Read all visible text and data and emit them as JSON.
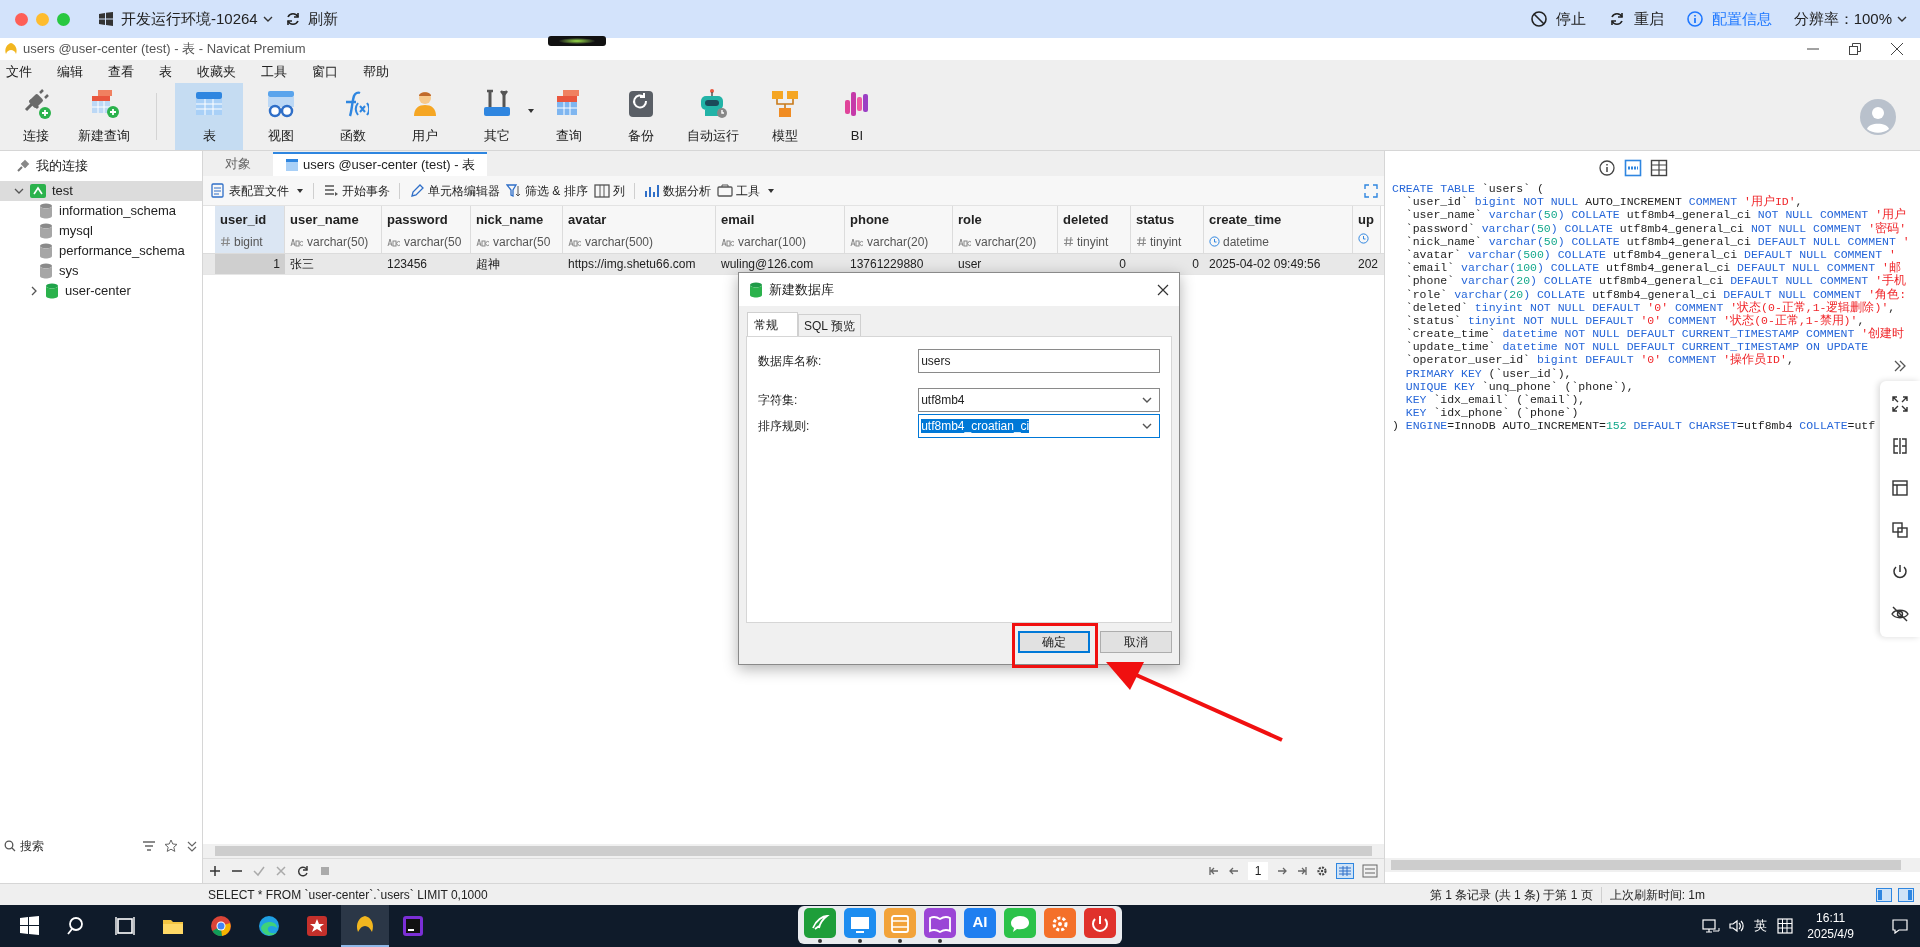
{
  "top_bar": {
    "environment": "开发运行环境-10264",
    "refresh": "刷新",
    "actions": [
      {
        "label": "停止",
        "kind": "stop"
      },
      {
        "label": "重启",
        "kind": "restart"
      },
      {
        "label": "配置信息",
        "kind": "info"
      }
    ],
    "resolution": "分辨率：100%"
  },
  "window": {
    "title": "users @user-center (test) - 表 - Navicat Premium"
  },
  "menu": [
    "文件",
    "编辑",
    "查看",
    "表",
    "收藏夹",
    "工具",
    "窗口",
    "帮助"
  ],
  "toolbar": [
    {
      "label": "连接",
      "selected": false,
      "dropdown": false
    },
    {
      "label": "新建查询",
      "selected": false,
      "dropdown": false
    },
    {
      "label": "表",
      "selected": true,
      "dropdown": false
    },
    {
      "label": "视图",
      "selected": false,
      "dropdown": false
    },
    {
      "label": "函数",
      "selected": false,
      "dropdown": false
    },
    {
      "label": "用户",
      "selected": false,
      "dropdown": false
    },
    {
      "label": "其它",
      "selected": false,
      "dropdown": true
    },
    {
      "label": "查询",
      "selected": false,
      "dropdown": false
    },
    {
      "label": "备份",
      "selected": false,
      "dropdown": false
    },
    {
      "label": "自动运行",
      "selected": false,
      "dropdown": false
    },
    {
      "label": "模型",
      "selected": false,
      "dropdown": false
    },
    {
      "label": "BI",
      "selected": false,
      "dropdown": false
    }
  ],
  "sidebar": {
    "header": "我的连接",
    "tree": [
      {
        "label": "test",
        "expanded": true,
        "selected": true,
        "children": [
          {
            "label": "information_schema",
            "open": false,
            "selected": false
          },
          {
            "label": "mysql",
            "open": false,
            "selected": false
          },
          {
            "label": "performance_schema",
            "open": false,
            "selected": false
          },
          {
            "label": "sys",
            "open": false,
            "selected": false
          },
          {
            "label": "user-center",
            "open": true,
            "selected": false,
            "expanded": false
          }
        ]
      }
    ],
    "search_placeholder": "搜索"
  },
  "tabs": [
    {
      "label": "对象",
      "selected": false
    },
    {
      "label": "users @user-center (test) - 表",
      "selected": true
    }
  ],
  "table_toolbar": [
    {
      "label": "表配置文件",
      "dropdown": true
    },
    {
      "label": "开始事务",
      "dropdown": false
    },
    {
      "label": "单元格编辑器",
      "dropdown": false
    },
    {
      "label": "筛选 & 排序",
      "dropdown": false
    },
    {
      "label": "列",
      "dropdown": false
    },
    {
      "label": "数据分析",
      "dropdown": false
    },
    {
      "label": "工具",
      "dropdown": true
    }
  ],
  "table": {
    "columns": [
      {
        "name": "user_id",
        "type": "bigint",
        "kind": "number"
      },
      {
        "name": "user_name",
        "type": "varchar(50)",
        "kind": "text"
      },
      {
        "name": "password",
        "type": "varchar(50",
        "kind": "text"
      },
      {
        "name": "nick_name",
        "type": "varchar(50",
        "kind": "text"
      },
      {
        "name": "avatar",
        "type": "varchar(500)",
        "kind": "text"
      },
      {
        "name": "email",
        "type": "varchar(100)",
        "kind": "text"
      },
      {
        "name": "phone",
        "type": "varchar(20)",
        "kind": "text"
      },
      {
        "name": "role",
        "type": "varchar(20)",
        "kind": "text"
      },
      {
        "name": "deleted",
        "type": "tinyint",
        "kind": "number"
      },
      {
        "name": "status",
        "type": "tinyint",
        "kind": "number"
      },
      {
        "name": "create_time",
        "type": "datetime",
        "kind": "time"
      },
      {
        "name": "up",
        "kind": "time"
      }
    ],
    "rows": [
      {
        "selected": true,
        "cells": [
          "1",
          "张三",
          "123456",
          "超神",
          "https://img.shetu66.com",
          "wuling@126.com",
          "13761229880",
          "user",
          "0",
          "0",
          "2025-04-02 09:49:56",
          "202"
        ]
      }
    ]
  },
  "pager": {
    "page": "1"
  },
  "status_bar": {
    "query": "SELECT * FROM `user-center`.`users` LIMIT 0,1000",
    "records": "第 1 条记录 (共 1 条) 于第 1 页",
    "refreshed": "上次刷新时间: 1m"
  },
  "ddl_panel": {
    "views": [
      {
        "selected": false
      },
      {
        "selected": true
      },
      {
        "selected": false
      }
    ],
    "lines": [
      [
        {
          "text": "CREATE TABLE",
          "kind": "kw"
        },
        {
          "text": " `users` (",
          "kind": "pl"
        }
      ],
      [
        {
          "text": "  `user_id` ",
          "kind": "pl"
        },
        {
          "text": "bigint NOT NULL",
          "kind": "kw"
        },
        {
          "text": " AUTO_INCREMENT ",
          "kind": "pl"
        },
        {
          "text": "COMMENT ",
          "kind": "kw"
        },
        {
          "text": "'用户ID'",
          "kind": "str"
        },
        {
          "text": ",",
          "kind": "pl"
        }
      ],
      [
        {
          "text": "  `user_name` ",
          "kind": "pl"
        },
        {
          "text": "varchar(",
          "kind": "kw"
        },
        {
          "text": "50",
          "kind": "num"
        },
        {
          "text": ") COLLATE",
          "kind": "kw"
        },
        {
          "text": " utf8mb4_general_ci ",
          "kind": "pl"
        },
        {
          "text": "NOT NULL COMMENT ",
          "kind": "kw"
        },
        {
          "text": "'用户",
          "kind": "str"
        }
      ],
      [
        {
          "text": "  `password` ",
          "kind": "pl"
        },
        {
          "text": "varchar(",
          "kind": "kw"
        },
        {
          "text": "50",
          "kind": "num"
        },
        {
          "text": ") COLLATE",
          "kind": "kw"
        },
        {
          "text": " utf8mb4_general_ci ",
          "kind": "pl"
        },
        {
          "text": "NOT NULL COMMENT ",
          "kind": "kw"
        },
        {
          "text": "'密码'",
          "kind": "str"
        }
      ],
      [
        {
          "text": "  `nick_name` ",
          "kind": "pl"
        },
        {
          "text": "varchar(",
          "kind": "kw"
        },
        {
          "text": "50",
          "kind": "num"
        },
        {
          "text": ") COLLATE",
          "kind": "kw"
        },
        {
          "text": " utf8mb4_general_ci ",
          "kind": "pl"
        },
        {
          "text": "DEFAULT NULL COMMENT ",
          "kind": "kw"
        },
        {
          "text": "'",
          "kind": "str"
        }
      ],
      [
        {
          "text": "  `avatar` ",
          "kind": "pl"
        },
        {
          "text": "varchar(",
          "kind": "kw"
        },
        {
          "text": "500",
          "kind": "num"
        },
        {
          "text": ") COLLATE",
          "kind": "kw"
        },
        {
          "text": " utf8mb4_general_ci ",
          "kind": "pl"
        },
        {
          "text": "DEFAULT NULL COMMENT ",
          "kind": "kw"
        },
        {
          "text": "'",
          "kind": "str"
        }
      ],
      [
        {
          "text": "  `email` ",
          "kind": "pl"
        },
        {
          "text": "varchar(",
          "kind": "kw"
        },
        {
          "text": "100",
          "kind": "num"
        },
        {
          "text": ") COLLATE",
          "kind": "kw"
        },
        {
          "text": " utf8mb4_general_ci ",
          "kind": "pl"
        },
        {
          "text": "DEFAULT NULL COMMENT ",
          "kind": "kw"
        },
        {
          "text": "'邮",
          "kind": "str"
        }
      ],
      [
        {
          "text": "  `phone` ",
          "kind": "pl"
        },
        {
          "text": "varchar(",
          "kind": "kw"
        },
        {
          "text": "20",
          "kind": "num"
        },
        {
          "text": ") COLLATE",
          "kind": "kw"
        },
        {
          "text": " utf8mb4_general_ci ",
          "kind": "pl"
        },
        {
          "text": "DEFAULT NULL COMMENT ",
          "kind": "kw"
        },
        {
          "text": "'手机",
          "kind": "str"
        }
      ],
      [
        {
          "text": "  `role` ",
          "kind": "pl"
        },
        {
          "text": "varchar(",
          "kind": "kw"
        },
        {
          "text": "20",
          "kind": "num"
        },
        {
          "text": ") COLLATE",
          "kind": "kw"
        },
        {
          "text": " utf8mb4_general_ci ",
          "kind": "pl"
        },
        {
          "text": "DEFAULT NULL COMMENT ",
          "kind": "kw"
        },
        {
          "text": "'角色:",
          "kind": "str"
        }
      ],
      [
        {
          "text": "  `deleted` ",
          "kind": "pl"
        },
        {
          "text": "tinyint NOT NULL DEFAULT ",
          "kind": "kw"
        },
        {
          "text": "'0' ",
          "kind": "str"
        },
        {
          "text": "COMMENT ",
          "kind": "kw"
        },
        {
          "text": "'状态(0-正常,1-逻辑删除)'",
          "kind": "str"
        },
        {
          "text": ",",
          "kind": "pl"
        }
      ],
      [
        {
          "text": "  `status` ",
          "kind": "pl"
        },
        {
          "text": "tinyint NOT NULL DEFAULT ",
          "kind": "kw"
        },
        {
          "text": "'0' ",
          "kind": "str"
        },
        {
          "text": "COMMENT ",
          "kind": "kw"
        },
        {
          "text": "'状态(0-正常,1-禁用)'",
          "kind": "str"
        },
        {
          "text": ",",
          "kind": "pl"
        }
      ],
      [
        {
          "text": "  `create_time` ",
          "kind": "pl"
        },
        {
          "text": "datetime NOT NULL DEFAULT CURRENT_TIMESTAMP COMMENT ",
          "kind": "kw"
        },
        {
          "text": "'创建时",
          "kind": "str"
        }
      ],
      [
        {
          "text": "  `update_time` ",
          "kind": "pl"
        },
        {
          "text": "datetime NOT NULL DEFAULT CURRENT_TIMESTAMP ON UPDATE",
          "kind": "kw"
        }
      ],
      [
        {
          "text": "  `operator_user_id` ",
          "kind": "pl"
        },
        {
          "text": "bigint DEFAULT ",
          "kind": "kw"
        },
        {
          "text": "'0' ",
          "kind": "str"
        },
        {
          "text": "COMMENT ",
          "kind": "kw"
        },
        {
          "text": "'操作员ID'",
          "kind": "str"
        },
        {
          "text": ",",
          "kind": "pl"
        }
      ],
      [
        {
          "text": "  PRIMARY KEY",
          "kind": "kw"
        },
        {
          "text": " (`user_id`),",
          "kind": "pl"
        }
      ],
      [
        {
          "text": "  UNIQUE KEY",
          "kind": "kw"
        },
        {
          "text": " `unq_phone` (`phone`),",
          "kind": "pl"
        }
      ],
      [
        {
          "text": "  KEY",
          "kind": "kw"
        },
        {
          "text": " `idx_email` (`email`),",
          "kind": "pl"
        }
      ],
      [
        {
          "text": "  KEY",
          "kind": "kw"
        },
        {
          "text": " `idx_phone` (`phone`)",
          "kind": "pl"
        }
      ],
      [
        {
          "text": ") ",
          "kind": "pl"
        },
        {
          "text": "ENGINE",
          "kind": "kw"
        },
        {
          "text": "=InnoDB AUTO_INCREMENT=",
          "kind": "pl"
        },
        {
          "text": "152",
          "kind": "num"
        },
        {
          "text": " DEFAULT CHARSET",
          "kind": "kw"
        },
        {
          "text": "=utf8mb4 ",
          "kind": "pl"
        },
        {
          "text": "COLLATE",
          "kind": "kw"
        },
        {
          "text": "=utf",
          "kind": "pl"
        }
      ]
    ]
  },
  "dialog": {
    "title": "新建数据库",
    "tabs": [
      {
        "label": "常规",
        "selected": true
      },
      {
        "label": "SQL 预览",
        "selected": false
      }
    ],
    "fields": [
      {
        "label": "数据库名称:",
        "value": "users",
        "kind": "text",
        "focused": false
      },
      {
        "label": "字符集:",
        "value": "utf8mb4",
        "kind": "select",
        "focused": false
      },
      {
        "label": "排序规则:",
        "value": "utf8mb4_croatian_ci",
        "kind": "select",
        "focused": true
      }
    ],
    "buttons": [
      {
        "label": "确定",
        "focused": true
      },
      {
        "label": "取消",
        "focused": false
      }
    ]
  },
  "taskbar": {
    "apps": [
      {
        "active": false
      },
      {
        "active": false
      },
      {
        "active": false
      },
      {
        "active": false
      },
      {
        "active": false
      },
      {
        "active": false
      },
      {
        "active": false
      },
      {
        "active": true
      },
      {
        "active": false
      }
    ],
    "dock": [
      {
        "running": true
      },
      {
        "running": true
      },
      {
        "running": true
      },
      {
        "running": true
      },
      {
        "running": false,
        "label": "AI"
      },
      {
        "running": false
      },
      {
        "running": false
      },
      {
        "running": false
      }
    ],
    "tray": {
      "language": "英",
      "time": "16:11",
      "date": "2025/4/9"
    }
  }
}
